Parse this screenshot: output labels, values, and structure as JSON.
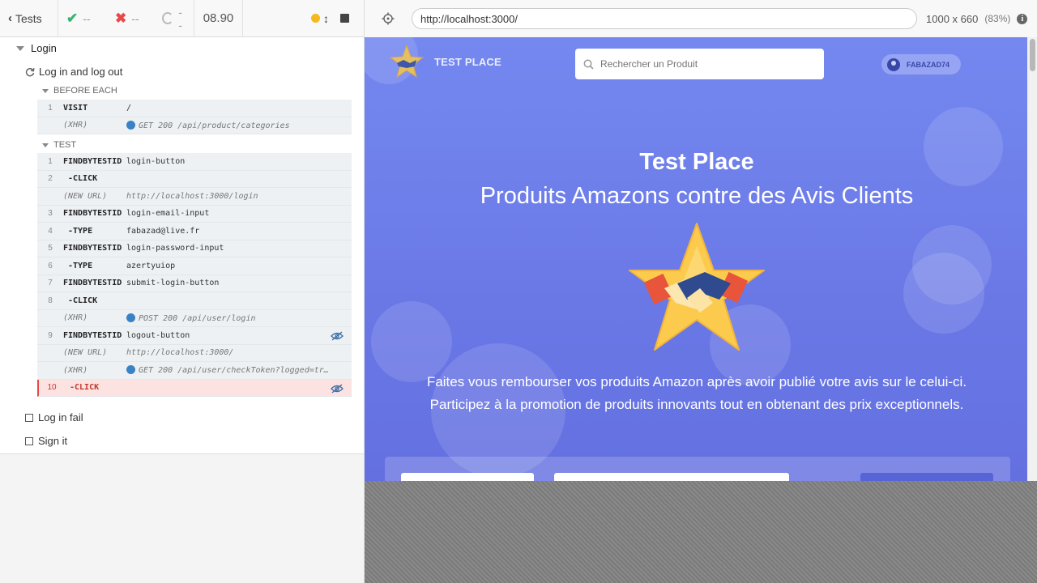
{
  "reporter": {
    "back_label": "Tests",
    "passed": "--",
    "failed": "--",
    "pending": "--",
    "duration": "08.90"
  },
  "suite": {
    "title": "Login",
    "test_title": "Log in and log out",
    "hooks": {
      "before_each": "BEFORE EACH",
      "test": "TEST"
    },
    "before_each_commands": [
      {
        "num": "1",
        "name": "VISIT",
        "msg": "/"
      },
      {
        "num": "",
        "name": "(XHR)",
        "msg": "GET 200 /api/product/categories"
      }
    ],
    "test_commands": [
      {
        "num": "1",
        "name": "FINDBYTESTID",
        "msg": "login-button"
      },
      {
        "num": "2",
        "name": "-CLICK",
        "msg": ""
      },
      {
        "num": "",
        "name": "(NEW URL)",
        "msg": "http://localhost:3000/login"
      },
      {
        "num": "3",
        "name": "FINDBYTESTID",
        "msg": "login-email-input"
      },
      {
        "num": "4",
        "name": "-TYPE",
        "msg": "fabazad@live.fr"
      },
      {
        "num": "5",
        "name": "FINDBYTESTID",
        "msg": "login-password-input"
      },
      {
        "num": "6",
        "name": "-TYPE",
        "msg": "azertyuiop"
      },
      {
        "num": "7",
        "name": "FINDBYTESTID",
        "msg": "submit-login-button"
      },
      {
        "num": "8",
        "name": "-CLICK",
        "msg": ""
      },
      {
        "num": "",
        "name": "(XHR)",
        "msg": "POST 200 /api/user/login"
      },
      {
        "num": "9",
        "name": "FINDBYTESTID",
        "msg": "logout-button"
      },
      {
        "num": "",
        "name": "(NEW URL)",
        "msg": "http://localhost:3000/"
      },
      {
        "num": "",
        "name": "(XHR)",
        "msg": "GET 200 /api/user/checkToken?logged=tr…"
      },
      {
        "num": "10",
        "name": "-CLICK",
        "msg": ""
      }
    ],
    "other_tests": [
      "Log in fail",
      "Sign it"
    ]
  },
  "browser": {
    "url": "http://localhost:3000/",
    "viewport": "1000 x 660",
    "scale": "(83%)"
  },
  "app": {
    "brand": "TEST PLACE",
    "search_placeholder": "Rechercher un Produit",
    "username": "FABAZAD74",
    "hero_title": "Test Place",
    "hero_subtitle": "Produits Amazons contre des Avis Clients",
    "hero_line1": "Faites vous rembourser vos produits Amazon après avoir publié votre avis sur le celui-ci.",
    "hero_line2": "Participez à la promotion de produits innovants tout en obtenant des prix exceptionnels."
  },
  "colors": {
    "pass": "#3cb371",
    "fail": "#e94848",
    "running": "#f6b81c",
    "xhr": "#3b82c4",
    "app_bg": "#7488f0"
  }
}
